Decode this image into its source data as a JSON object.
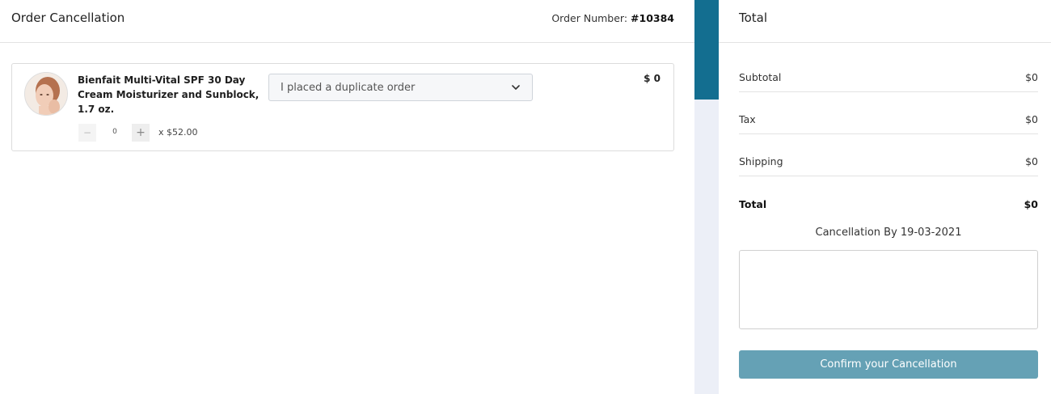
{
  "header": {
    "title": "Order Cancellation",
    "order_number_label": "Order Number:",
    "order_number": "#10384"
  },
  "item": {
    "name": "Bienfait Multi-Vital SPF 30 Day Cream Moisturizer and Sunblock, 1.7 oz.",
    "qty_minus": "−",
    "quantity": "0",
    "qty_plus": "+",
    "unit_price": "x $52.00",
    "reason_selected": "I placed a duplicate order",
    "line_total": "$ 0"
  },
  "summary": {
    "title": "Total",
    "rows": [
      {
        "label": "Subtotal",
        "value": "$0"
      },
      {
        "label": "Tax",
        "value": "$0"
      },
      {
        "label": "Shipping",
        "value": "$0"
      },
      {
        "label": "Total",
        "value": "$0"
      }
    ],
    "cancellation_by": "Cancellation By 19-03-2021",
    "confirm_label": "Confirm your Cancellation"
  },
  "colors": {
    "accent": "#136e90",
    "button": "#65a1b5",
    "strip": "#eceff7"
  },
  "icons": {
    "product_image": "product-avatar",
    "select_arrow": "chevron-down-icon"
  }
}
